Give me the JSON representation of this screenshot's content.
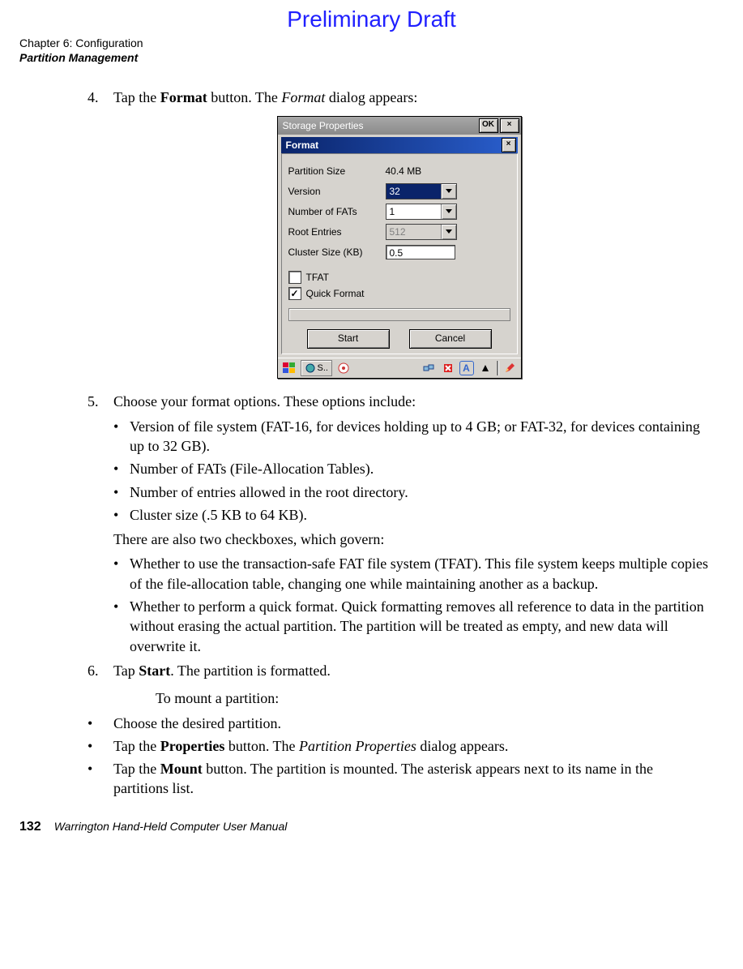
{
  "watermark": "Preliminary Draft",
  "chapter": {
    "line1": "Chapter 6: Configuration",
    "line2": "Partition Management"
  },
  "steps": {
    "s4": {
      "num": "4.",
      "pre": "Tap the ",
      "bold": "Format",
      "mid": " button. The ",
      "ital": "Format",
      "post": " dialog appears:"
    },
    "s5": {
      "num": "5.",
      "text": "Choose your format options. These options include:"
    },
    "s5_bullets": [
      "Version of file system (FAT-16, for devices holding up to 4 GB; or FAT-32, for devices containing up to 32 GB).",
      "Number of FATs (File-Allocation Tables).",
      "Number of entries allowed in the root directory.",
      "Cluster size (.5 KB to 64 KB)."
    ],
    "s5_note": "There are also two checkboxes, which govern:",
    "s5_bullets2": [
      "Whether to use the transaction-safe FAT file system (TFAT). This file system keeps multiple copies of the file-allocation table, changing one while maintaining another as a backup.",
      "Whether to perform a quick format. Quick formatting removes all reference to data in the partition without erasing the actual partition. The partition will be treated as empty, and new data will overwrite it."
    ],
    "s6": {
      "num": "6.",
      "pre": "Tap ",
      "bold": "Start",
      "post": ". The partition is formatted."
    }
  },
  "mount": {
    "title": "To mount a partition:",
    "b1": "Choose the desired partition.",
    "b2": {
      "pre": "Tap the ",
      "bold": "Properties",
      "mid": " button. The ",
      "ital": "Partition Properties",
      "post": " dialog appears."
    },
    "b3": {
      "pre": "Tap the ",
      "bold": "Mount",
      "post": " button. The partition is mounted. The asterisk appears next to its name in the partitions list."
    }
  },
  "dialog": {
    "outer_title": "Storage Properties",
    "ok": "OK",
    "close": "×",
    "inner_title": "Format",
    "labels": {
      "partition_size": "Partition Size",
      "version": "Version",
      "num_fats": "Number of FATs",
      "root_entries": "Root Entries",
      "cluster_size": "Cluster Size (KB)"
    },
    "values": {
      "partition_size": "40.4 MB",
      "version": "32",
      "num_fats": "1",
      "root_entries": "512",
      "cluster_size": "0.5"
    },
    "check_tfat": "TFAT",
    "check_quick": "Quick Format",
    "check_mark": "✓",
    "btn_start": "Start",
    "btn_cancel": "Cancel",
    "taskbar": {
      "tab": "S..",
      "ime": "A"
    }
  },
  "footer": {
    "page": "132",
    "manual": "Warrington Hand-Held Computer User Manual"
  },
  "bullet": "•"
}
